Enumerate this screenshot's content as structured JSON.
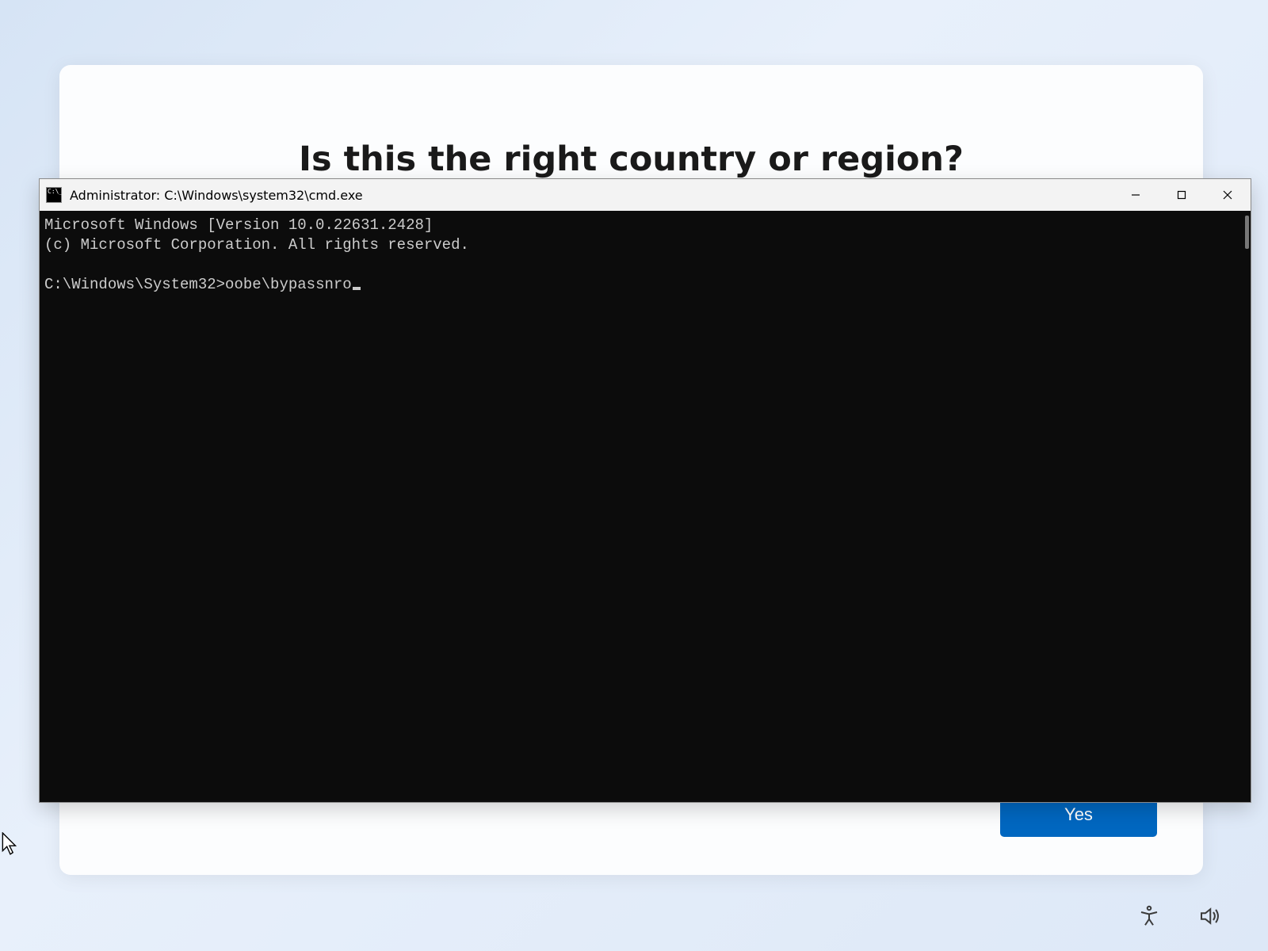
{
  "oobe": {
    "title": "Is this the right country or region?",
    "yes_label": "Yes"
  },
  "cmd": {
    "window_title": "Administrator: C:\\Windows\\system32\\cmd.exe",
    "line1": "Microsoft Windows [Version 10.0.22631.2428]",
    "line2": "(c) Microsoft Corporation. All rights reserved.",
    "prompt": "C:\\Windows\\System32>",
    "typed_command": "oobe\\bypassnro"
  }
}
